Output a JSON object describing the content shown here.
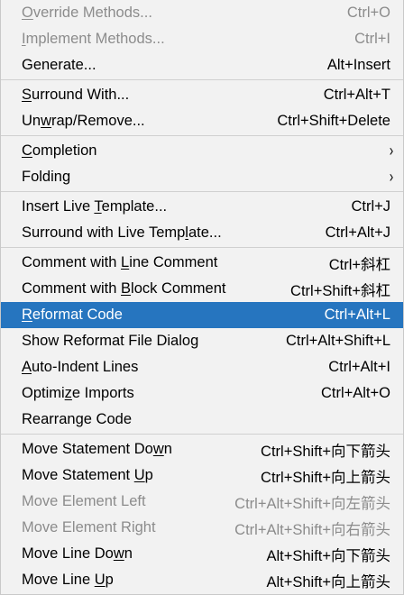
{
  "menu": {
    "items": [
      {
        "name": "override-methods",
        "pre": "",
        "m": "O",
        "post": "verride Methods...",
        "shortcut": "Ctrl+O",
        "disabled": true,
        "selected": false,
        "submenu": false
      },
      {
        "name": "implement-methods",
        "pre": "",
        "m": "I",
        "post": "mplement Methods...",
        "shortcut": "Ctrl+I",
        "disabled": true,
        "selected": false,
        "submenu": false
      },
      {
        "name": "generate",
        "pre": "Generate...",
        "m": "",
        "post": "",
        "shortcut": "Alt+Insert",
        "disabled": false,
        "selected": false,
        "submenu": false,
        "sep_after": true
      },
      {
        "name": "surround-with",
        "pre": "",
        "m": "S",
        "post": "urround With...",
        "shortcut": "Ctrl+Alt+T",
        "disabled": false,
        "selected": false,
        "submenu": false
      },
      {
        "name": "unwrap-remove",
        "pre": "Un",
        "m": "w",
        "post": "rap/Remove...",
        "shortcut": "Ctrl+Shift+Delete",
        "disabled": false,
        "selected": false,
        "submenu": false,
        "sep_after": true
      },
      {
        "name": "completion",
        "pre": "",
        "m": "C",
        "post": "ompletion",
        "shortcut": "",
        "disabled": false,
        "selected": false,
        "submenu": true
      },
      {
        "name": "folding",
        "pre": "Folding",
        "m": "",
        "post": "",
        "shortcut": "",
        "disabled": false,
        "selected": false,
        "submenu": true,
        "sep_after": true
      },
      {
        "name": "insert-live-template",
        "pre": "Insert Live ",
        "m": "T",
        "post": "emplate...",
        "shortcut": "Ctrl+J",
        "disabled": false,
        "selected": false,
        "submenu": false
      },
      {
        "name": "surround-with-live-template",
        "pre": "Surround with Live Temp",
        "m": "l",
        "post": "ate...",
        "shortcut": "Ctrl+Alt+J",
        "disabled": false,
        "selected": false,
        "submenu": false,
        "sep_after": true
      },
      {
        "name": "comment-line",
        "pre": "Comment with ",
        "m": "L",
        "post": "ine Comment",
        "shortcut": "Ctrl+斜杠",
        "disabled": false,
        "selected": false,
        "submenu": false
      },
      {
        "name": "comment-block",
        "pre": "Comment with ",
        "m": "B",
        "post": "lock Comment",
        "shortcut": "Ctrl+Shift+斜杠",
        "disabled": false,
        "selected": false,
        "submenu": false
      },
      {
        "name": "reformat-code",
        "pre": "",
        "m": "R",
        "post": "eformat Code",
        "shortcut": "Ctrl+Alt+L",
        "disabled": false,
        "selected": true,
        "submenu": false
      },
      {
        "name": "show-reformat-file-dialog",
        "pre": "Show Reformat File Dialog",
        "m": "",
        "post": "",
        "shortcut": "Ctrl+Alt+Shift+L",
        "disabled": false,
        "selected": false,
        "submenu": false
      },
      {
        "name": "auto-indent-lines",
        "pre": "",
        "m": "A",
        "post": "uto-Indent Lines",
        "shortcut": "Ctrl+Alt+I",
        "disabled": false,
        "selected": false,
        "submenu": false
      },
      {
        "name": "optimize-imports",
        "pre": "Optimi",
        "m": "z",
        "post": "e Imports",
        "shortcut": "Ctrl+Alt+O",
        "disabled": false,
        "selected": false,
        "submenu": false
      },
      {
        "name": "rearrange-code",
        "pre": "Rearrange Code",
        "m": "",
        "post": "",
        "shortcut": "",
        "disabled": false,
        "selected": false,
        "submenu": false,
        "sep_after": true
      },
      {
        "name": "move-statement-down",
        "pre": "Move Statement Do",
        "m": "w",
        "post": "n",
        "shortcut": "Ctrl+Shift+向下箭头",
        "disabled": false,
        "selected": false,
        "submenu": false
      },
      {
        "name": "move-statement-up",
        "pre": "Move Statement ",
        "m": "U",
        "post": "p",
        "shortcut": "Ctrl+Shift+向上箭头",
        "disabled": false,
        "selected": false,
        "submenu": false
      },
      {
        "name": "move-element-left",
        "pre": "Move Element Left",
        "m": "",
        "post": "",
        "shortcut": "Ctrl+Alt+Shift+向左箭头",
        "disabled": true,
        "selected": false,
        "submenu": false
      },
      {
        "name": "move-element-right",
        "pre": "Move Element Right",
        "m": "",
        "post": "",
        "shortcut": "Ctrl+Alt+Shift+向右箭头",
        "disabled": true,
        "selected": false,
        "submenu": false
      },
      {
        "name": "move-line-down",
        "pre": "Move Line Do",
        "m": "w",
        "post": "n",
        "shortcut": "Alt+Shift+向下箭头",
        "disabled": false,
        "selected": false,
        "submenu": false
      },
      {
        "name": "move-line-up",
        "pre": "Move Line ",
        "m": "U",
        "post": "p",
        "shortcut": "Alt+Shift+向上箭头",
        "disabled": false,
        "selected": false,
        "submenu": false
      }
    ],
    "submenu_glyph": "›",
    "colors": {
      "background": "#f2f2f2",
      "selected": "#2675bf",
      "text": "#000000",
      "disabled_text": "#8c8c8c",
      "separator": "#d0d0d0"
    }
  }
}
